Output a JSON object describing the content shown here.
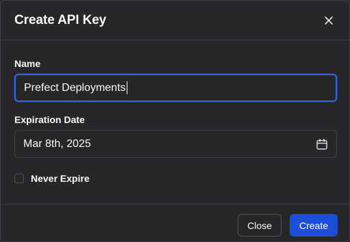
{
  "dialog": {
    "title": "Create API Key",
    "close_icon": "close-icon"
  },
  "form": {
    "name_label": "Name",
    "name_value": "Prefect Deployments",
    "expiration_label": "Expiration Date",
    "expiration_value": "Mar 8th, 2025",
    "calendar_icon": "calendar-icon",
    "never_expire_label": "Never Expire",
    "never_expire_checked": false
  },
  "footer": {
    "close_label": "Close",
    "create_label": "Create"
  },
  "colors": {
    "background": "#27272a",
    "border": "#3f3f46",
    "focus_ring": "#3b63d6",
    "primary_button": "#1d4ed8"
  }
}
